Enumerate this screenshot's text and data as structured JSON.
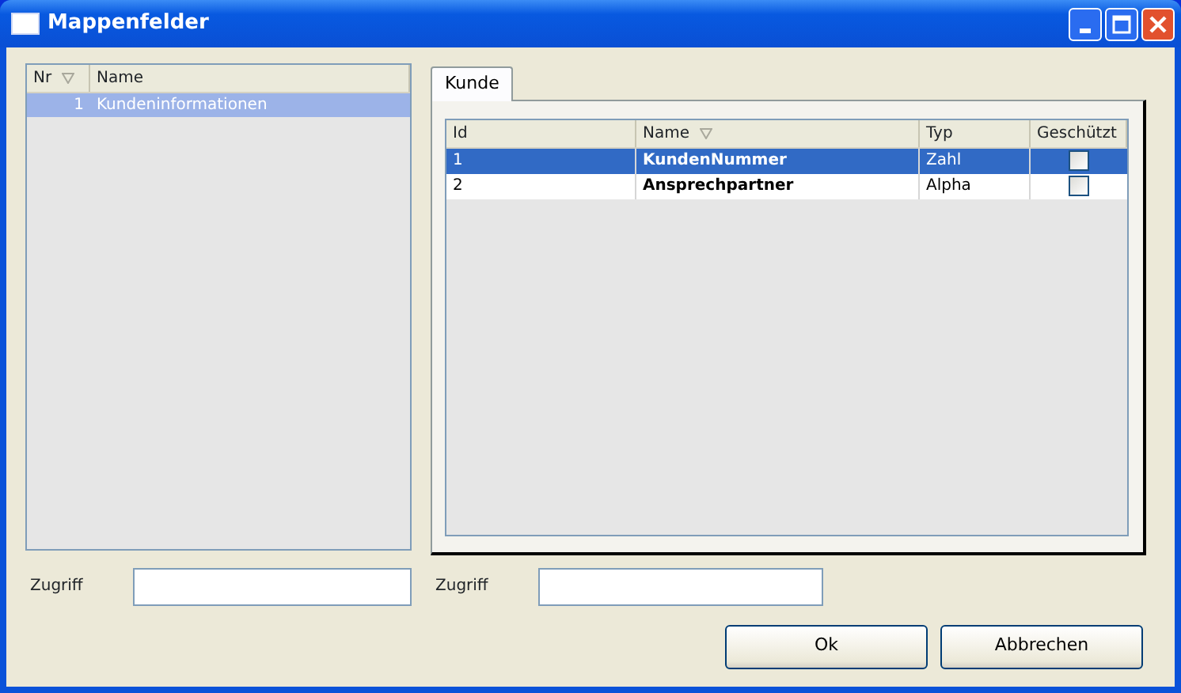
{
  "window": {
    "title": "Mappenfelder"
  },
  "left_list": {
    "columns": [
      {
        "label": "Nr",
        "sort_icon": true
      },
      {
        "label": "Name"
      }
    ],
    "rows": [
      {
        "nr": "1",
        "name": "Kundeninformationen",
        "selected": true
      }
    ]
  },
  "tabs": [
    {
      "label": "Kunde",
      "selected": true
    }
  ],
  "grid": {
    "columns": [
      {
        "label": "Id"
      },
      {
        "label": "Name",
        "sort_icon": true
      },
      {
        "label": "Typ"
      },
      {
        "label": "Geschützt"
      }
    ],
    "rows": [
      {
        "id": "1",
        "name": "KundenNummer",
        "typ": "Zahl",
        "protected": false,
        "selected": true
      },
      {
        "id": "2",
        "name": "Ansprechpartner",
        "typ": "Alpha",
        "protected": false,
        "selected": false
      }
    ]
  },
  "left_filter": {
    "label": "Zugriff"
  },
  "right_filter": {
    "label": "Zugriff"
  },
  "buttons": [
    {
      "label": "Ok"
    },
    {
      "label": "Abbrechen"
    }
  ]
}
